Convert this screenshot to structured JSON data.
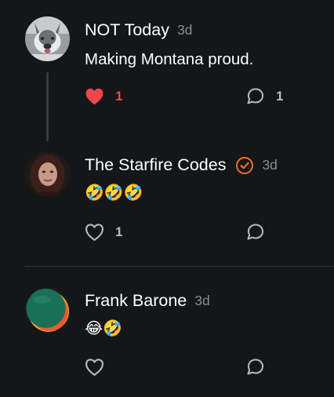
{
  "comments": [
    {
      "author": "NOT Today",
      "time": "3d",
      "text": "Making Montana proud.",
      "like_count": "1",
      "reply_count": "1",
      "liked": true
    },
    {
      "author": "The Starfire Codes",
      "time": "3d",
      "verified": true,
      "text": "🤣🤣🤣",
      "like_count": "1",
      "reply_count": "",
      "liked": false
    },
    {
      "author": "Frank Barone",
      "time": "3d",
      "text": "😂🤣",
      "like_count": "",
      "reply_count": "",
      "liked": false
    }
  ],
  "icons": {
    "like": "heart-icon",
    "reply": "speech-bubble-icon",
    "verified": "check-circle-icon"
  },
  "colors": {
    "background": "#151618",
    "liked": "#f0474d",
    "verified": "#f26f2a",
    "muted": "#8b8d92"
  }
}
